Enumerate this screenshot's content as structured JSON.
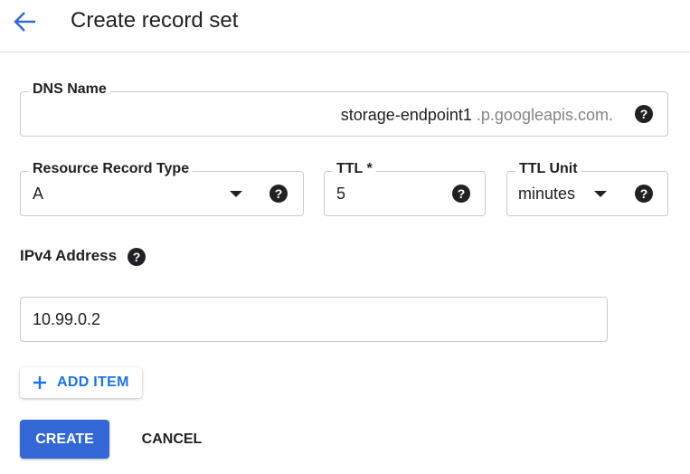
{
  "header": {
    "title": "Create record set"
  },
  "dns_name": {
    "label": "DNS Name",
    "value": "storage-endpoint1",
    "suffix": ".p.googleapis.com."
  },
  "record_type": {
    "label": "Resource Record Type",
    "value": "A"
  },
  "ttl": {
    "label": "TTL *",
    "value": "5"
  },
  "ttl_unit": {
    "label": "TTL Unit",
    "value": "minutes"
  },
  "ipv4": {
    "label": "IPv4 Address",
    "value": "10.99.0.2"
  },
  "buttons": {
    "add_item": "ADD ITEM",
    "create": "CREATE",
    "cancel": "CANCEL"
  },
  "colors": {
    "accent": "#1a73e8",
    "primary_button": "#3367d6",
    "border": "#c9cbcf"
  }
}
